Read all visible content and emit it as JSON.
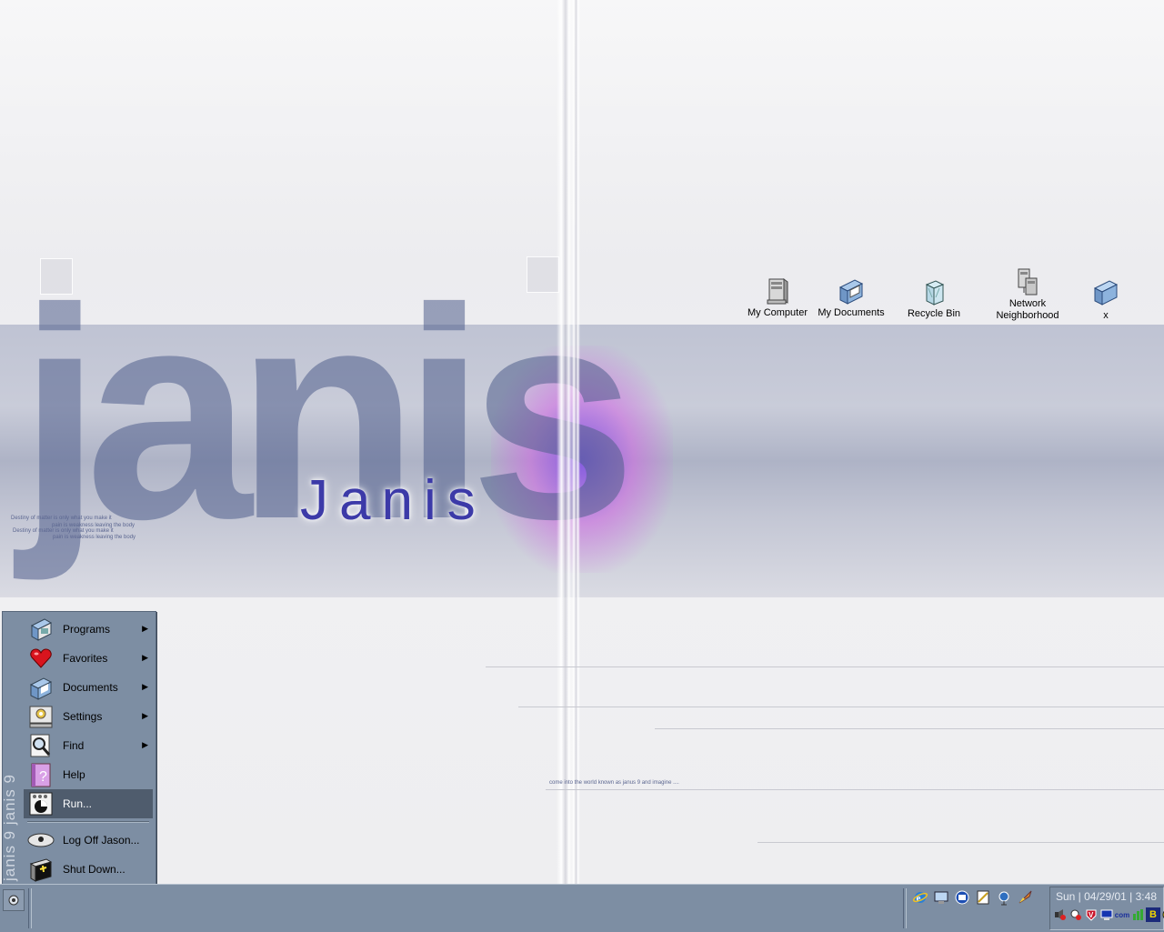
{
  "wallpaper": {
    "big_text": "janis",
    "title": "Janis",
    "small_text_lines": [
      "Destiny of matter is only what you make it",
      "pain is weakness leaving the body",
      "Destiny of matter is only what you make it",
      "pain is weakness leaving the body"
    ],
    "caption": "come into the world known as janus 9 and imagine ....",
    "band_color": "#bfc3d3",
    "accent_color": "#3c3aa8"
  },
  "desktop_icons": [
    {
      "label": "My Computer",
      "icon": "computer-icon"
    },
    {
      "label": "My Documents",
      "icon": "documents-folder-icon"
    },
    {
      "label": "Recycle Bin",
      "icon": "recycle-bin-icon"
    },
    {
      "label": "Network Neighborhood",
      "icon": "network-icon"
    },
    {
      "label": "x",
      "icon": "folder-icon"
    }
  ],
  "start_menu": {
    "banner_text": "janis 9 janis 9",
    "items": [
      {
        "label": "Programs",
        "icon": "programs-icon",
        "submenu": true
      },
      {
        "label": "Favorites",
        "icon": "heart-icon",
        "submenu": true
      },
      {
        "label": "Documents",
        "icon": "documents-icon",
        "submenu": true
      },
      {
        "label": "Settings",
        "icon": "settings-icon",
        "submenu": true
      },
      {
        "label": "Find",
        "icon": "magnifier-icon",
        "submenu": true
      },
      {
        "label": "Help",
        "icon": "help-icon",
        "submenu": false
      },
      {
        "label": "Run...",
        "icon": "run-icon",
        "submenu": false,
        "active": true
      }
    ],
    "bottom_items": [
      {
        "label": "Log Off Jason...",
        "icon": "eye-icon"
      },
      {
        "label": "Shut Down...",
        "icon": "shutdown-icon"
      }
    ]
  },
  "taskbar": {
    "color": "#7d8ea3",
    "clock": "Sun | 04/29/01 | 3:48",
    "quicklaunch_icons": [
      "internet-explorer-icon",
      "desktop-icon",
      "outlook-icon",
      "notepad-icon",
      "satellite-icon",
      "rocket-icon"
    ],
    "tray_icons": [
      "volume-icon",
      "network-tray-icon",
      "antivirus-icon",
      "display-icon",
      "com-icon",
      "bluetooth-b-icon",
      "accessibility-icon"
    ],
    "tray_letters": {
      "com": "com",
      "b": "B"
    }
  }
}
